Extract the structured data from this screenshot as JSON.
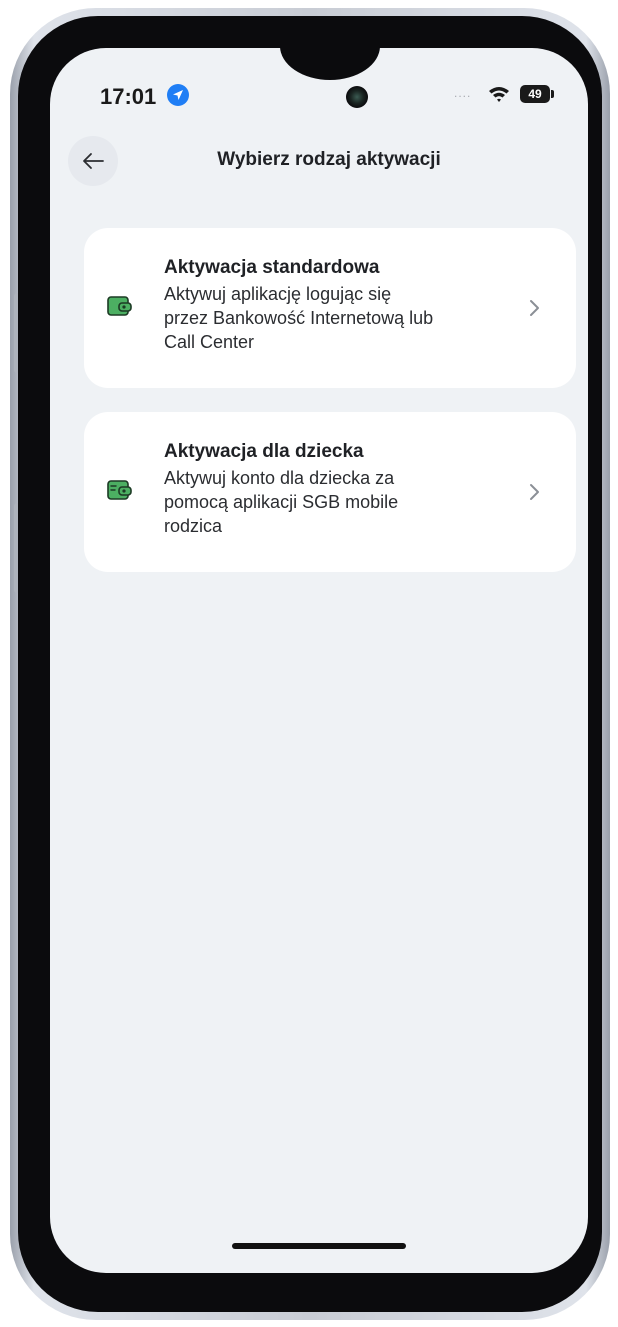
{
  "status_bar": {
    "time": "17:01",
    "signal": "....",
    "battery": "49"
  },
  "header": {
    "title": "Wybierz rodzaj aktywacji"
  },
  "options": [
    {
      "title": "Aktywacja standardowa",
      "description_lines": [
        "Aktywuj aplikację logując się",
        "przez Bankowość Internetową lub",
        "Call Center"
      ]
    },
    {
      "title": "Aktywacja dla dziecka",
      "description_lines": [
        "Aktywuj konto dla dziecka za",
        "pomocą aplikacji SGB mobile",
        "rodzica"
      ]
    }
  ],
  "colors": {
    "accent_blue": "#1f7ef5",
    "icon_green": "#3fae5a",
    "screen_bg": "#eff2f5",
    "card_bg": "#ffffff"
  },
  "icons": {
    "back": "arrow-left-icon",
    "location": "location-arrow-icon",
    "wifi": "wifi-icon",
    "battery": "battery-icon",
    "option_standard": "wallet-icon",
    "option_child": "child-wallet-icon",
    "chevron": "chevron-right-icon"
  }
}
